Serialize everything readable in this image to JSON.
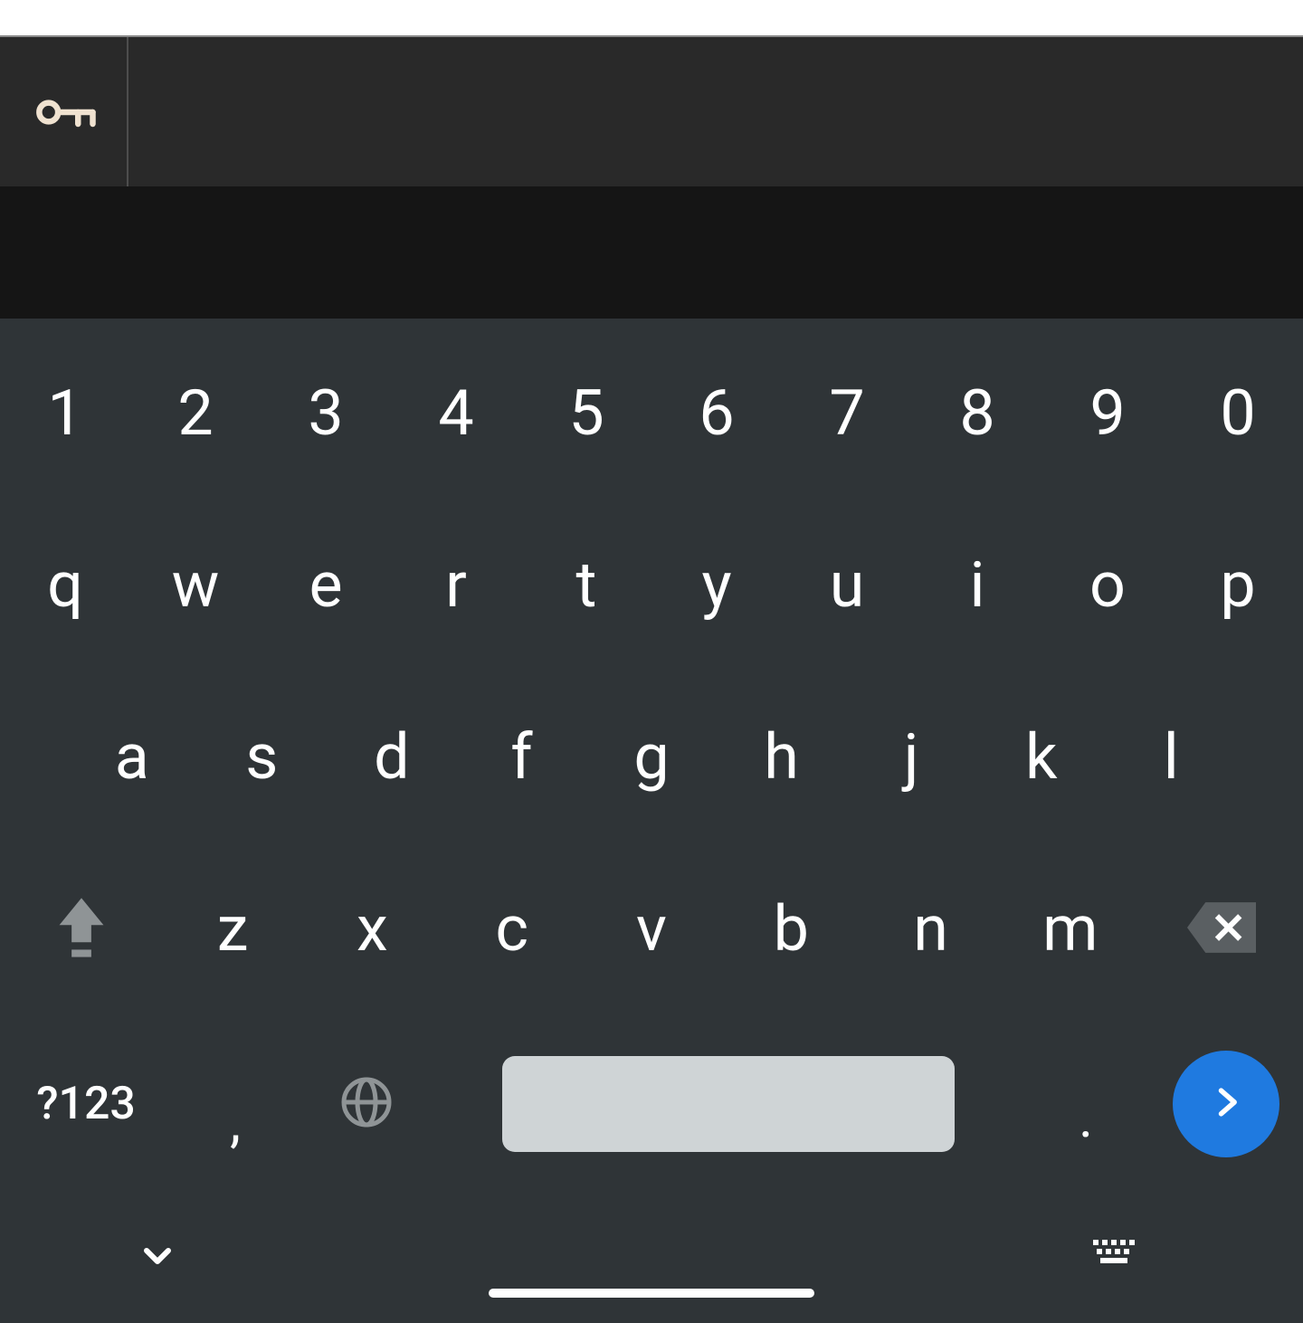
{
  "suggestion_bar": {
    "password_icon": "key-icon"
  },
  "keyboard": {
    "row_numbers": [
      "1",
      "2",
      "3",
      "4",
      "5",
      "6",
      "7",
      "8",
      "9",
      "0"
    ],
    "row_q": [
      "q",
      "w",
      "e",
      "r",
      "t",
      "y",
      "u",
      "i",
      "o",
      "p"
    ],
    "row_a": [
      "a",
      "s",
      "d",
      "f",
      "g",
      "h",
      "j",
      "k",
      "l"
    ],
    "row_z": [
      "z",
      "x",
      "c",
      "v",
      "b",
      "n",
      "m"
    ],
    "symbols_label": "?123",
    "comma": ",",
    "period": ".",
    "shift_icon": "shift",
    "backspace_icon": "backspace",
    "globe_icon": "globe",
    "enter_icon": "arrow-right"
  },
  "navbar": {
    "collapse_icon": "chevron-down",
    "switcher_icon": "keyboard-switch"
  }
}
